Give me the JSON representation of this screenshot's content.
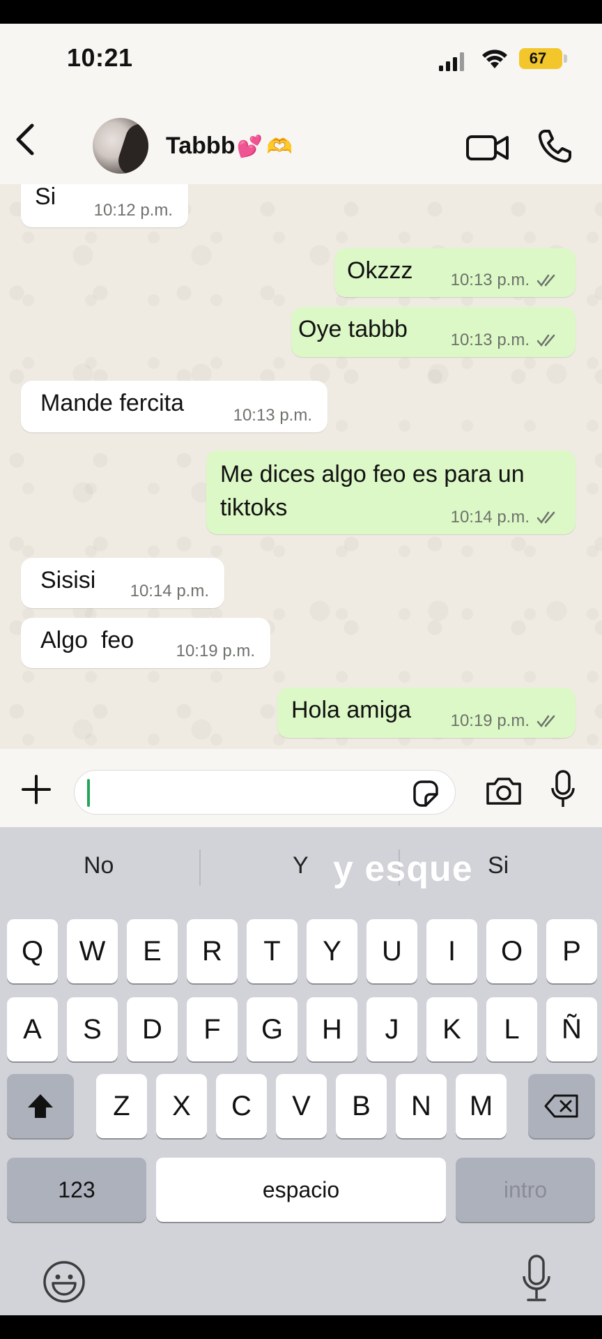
{
  "status_bar": {
    "time": "10:21",
    "battery": "67"
  },
  "header": {
    "contact_name": "Tabbb",
    "contact_emoji": "💕",
    "contact_emoji2": "🫶"
  },
  "messages": [
    {
      "dir": "in",
      "text": "Si",
      "time": "10:12 p.m."
    },
    {
      "dir": "out",
      "text": "Okzzz",
      "time": "10:13 p.m."
    },
    {
      "dir": "out",
      "text": "Oye tabbb",
      "time": "10:13 p.m."
    },
    {
      "dir": "in",
      "text": "Mande fercita",
      "time": "10:13 p.m."
    },
    {
      "dir": "out",
      "text": "Me dices algo feo es para un tiktoks",
      "time": "10:14 p.m."
    },
    {
      "dir": "in",
      "text": "Sisisi",
      "time": "10:14 p.m."
    },
    {
      "dir": "in",
      "text": "Algo  feo",
      "time": "10:19 p.m."
    },
    {
      "dir": "out",
      "text": "Hola amiga",
      "time": "10:19 p.m."
    }
  ],
  "composer": {
    "value": ""
  },
  "keyboard": {
    "suggestions": [
      "No",
      "Y",
      "Si"
    ],
    "overlay_caption": "y esque",
    "row1": [
      "Q",
      "W",
      "E",
      "R",
      "T",
      "Y",
      "U",
      "I",
      "O",
      "P"
    ],
    "row2": [
      "A",
      "S",
      "D",
      "F",
      "G",
      "H",
      "J",
      "K",
      "L",
      "Ñ"
    ],
    "row3": [
      "Z",
      "X",
      "C",
      "V",
      "B",
      "N",
      "M"
    ],
    "numbers_label": "123",
    "space_label": "espacio",
    "return_label": "intro"
  },
  "colors": {
    "outgoing_bubble": "#dcf8c6",
    "incoming_bubble": "#ffffff",
    "caret": "#25a35a",
    "battery": "#f3c62c"
  }
}
